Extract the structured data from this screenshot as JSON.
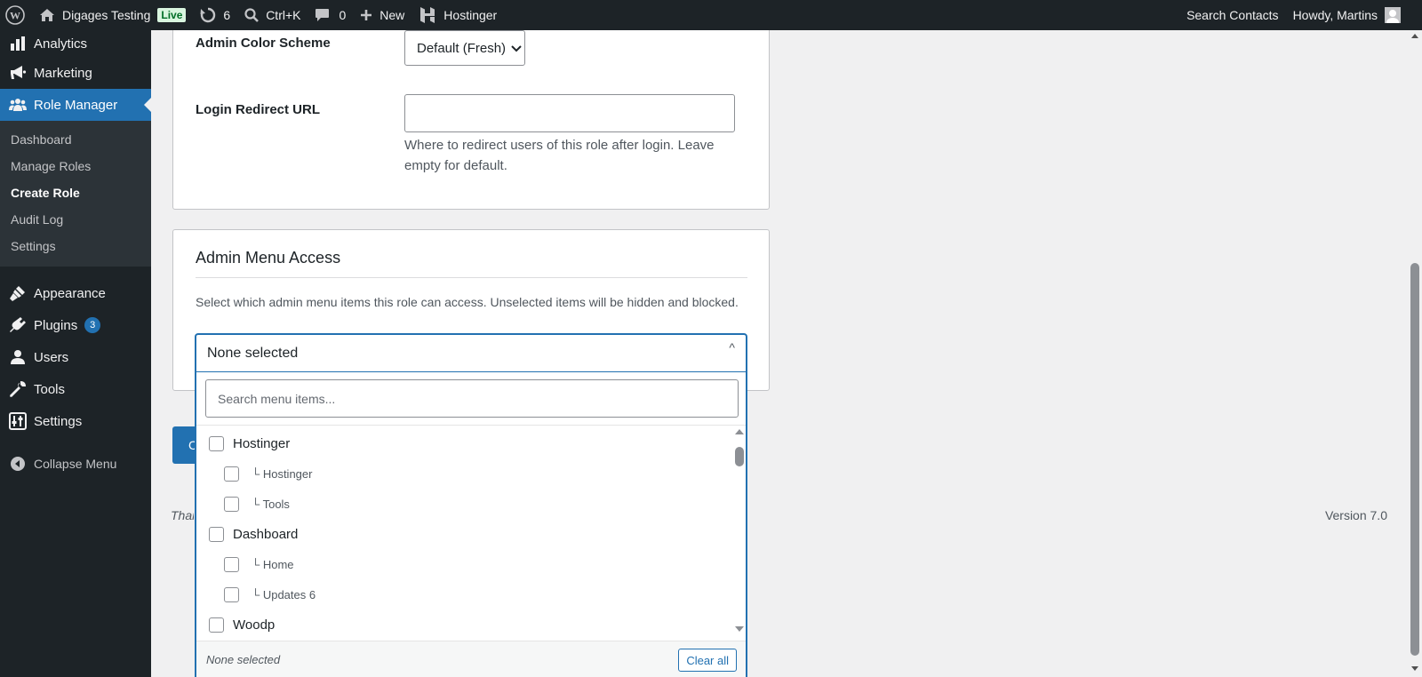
{
  "adminbar": {
    "site_name": "Digages Testing",
    "live_badge": "Live",
    "updates_count": "6",
    "shortcut": "Ctrl+K",
    "comments_count": "0",
    "new_label": "New",
    "hostinger_label": "Hostinger",
    "search_contacts": "Search Contacts",
    "greeting": "Howdy, Martins"
  },
  "sidebar": {
    "items_top": [
      {
        "label": "Analytics",
        "icon": "chart-bar-icon"
      },
      {
        "label": "Marketing",
        "icon": "megaphone-icon"
      },
      {
        "label": "Role Manager",
        "icon": "groups-icon"
      }
    ],
    "submenu": [
      "Dashboard",
      "Manage Roles",
      "Create Role",
      "Audit Log",
      "Settings"
    ],
    "active_submenu": "Create Role",
    "items_bottom": [
      {
        "label": "Appearance",
        "icon": "paintbrush-icon"
      },
      {
        "label": "Plugins",
        "icon": "plugin-icon",
        "badge": "3"
      },
      {
        "label": "Users",
        "icon": "user-icon"
      },
      {
        "label": "Tools",
        "icon": "wrench-icon"
      },
      {
        "label": "Settings",
        "icon": "settings-icon"
      }
    ],
    "collapse_label": "Collapse Menu"
  },
  "form": {
    "color_scheme_label": "Admin Color Scheme",
    "color_scheme_value": "Default (Fresh)",
    "login_redirect_label": "Login Redirect URL",
    "login_redirect_value": "",
    "login_redirect_help": "Where to redirect users of this role after login. Leave empty for default."
  },
  "menu_access": {
    "title": "Admin Menu Access",
    "description": "Select which admin menu items this role can access. Unselected items will be hidden and blocked.",
    "selected_text": "None selected",
    "caret": "^",
    "search_placeholder": "Search menu items...",
    "options": [
      {
        "label": "Hostinger",
        "level": 0
      },
      {
        "label": "└ Hostinger",
        "level": 1
      },
      {
        "label": "└ Tools",
        "level": 1
      },
      {
        "label": "Dashboard",
        "level": 0
      },
      {
        "label": "└ Home",
        "level": 1
      },
      {
        "label": "└ Updates 6",
        "level": 1
      },
      {
        "label": "Woodp",
        "level": 0
      }
    ],
    "footer_status": "None selected",
    "clear_all": "Clear all"
  },
  "primary_button": "C",
  "footer": {
    "thanks": "Than",
    "version": "Version 7.0"
  }
}
